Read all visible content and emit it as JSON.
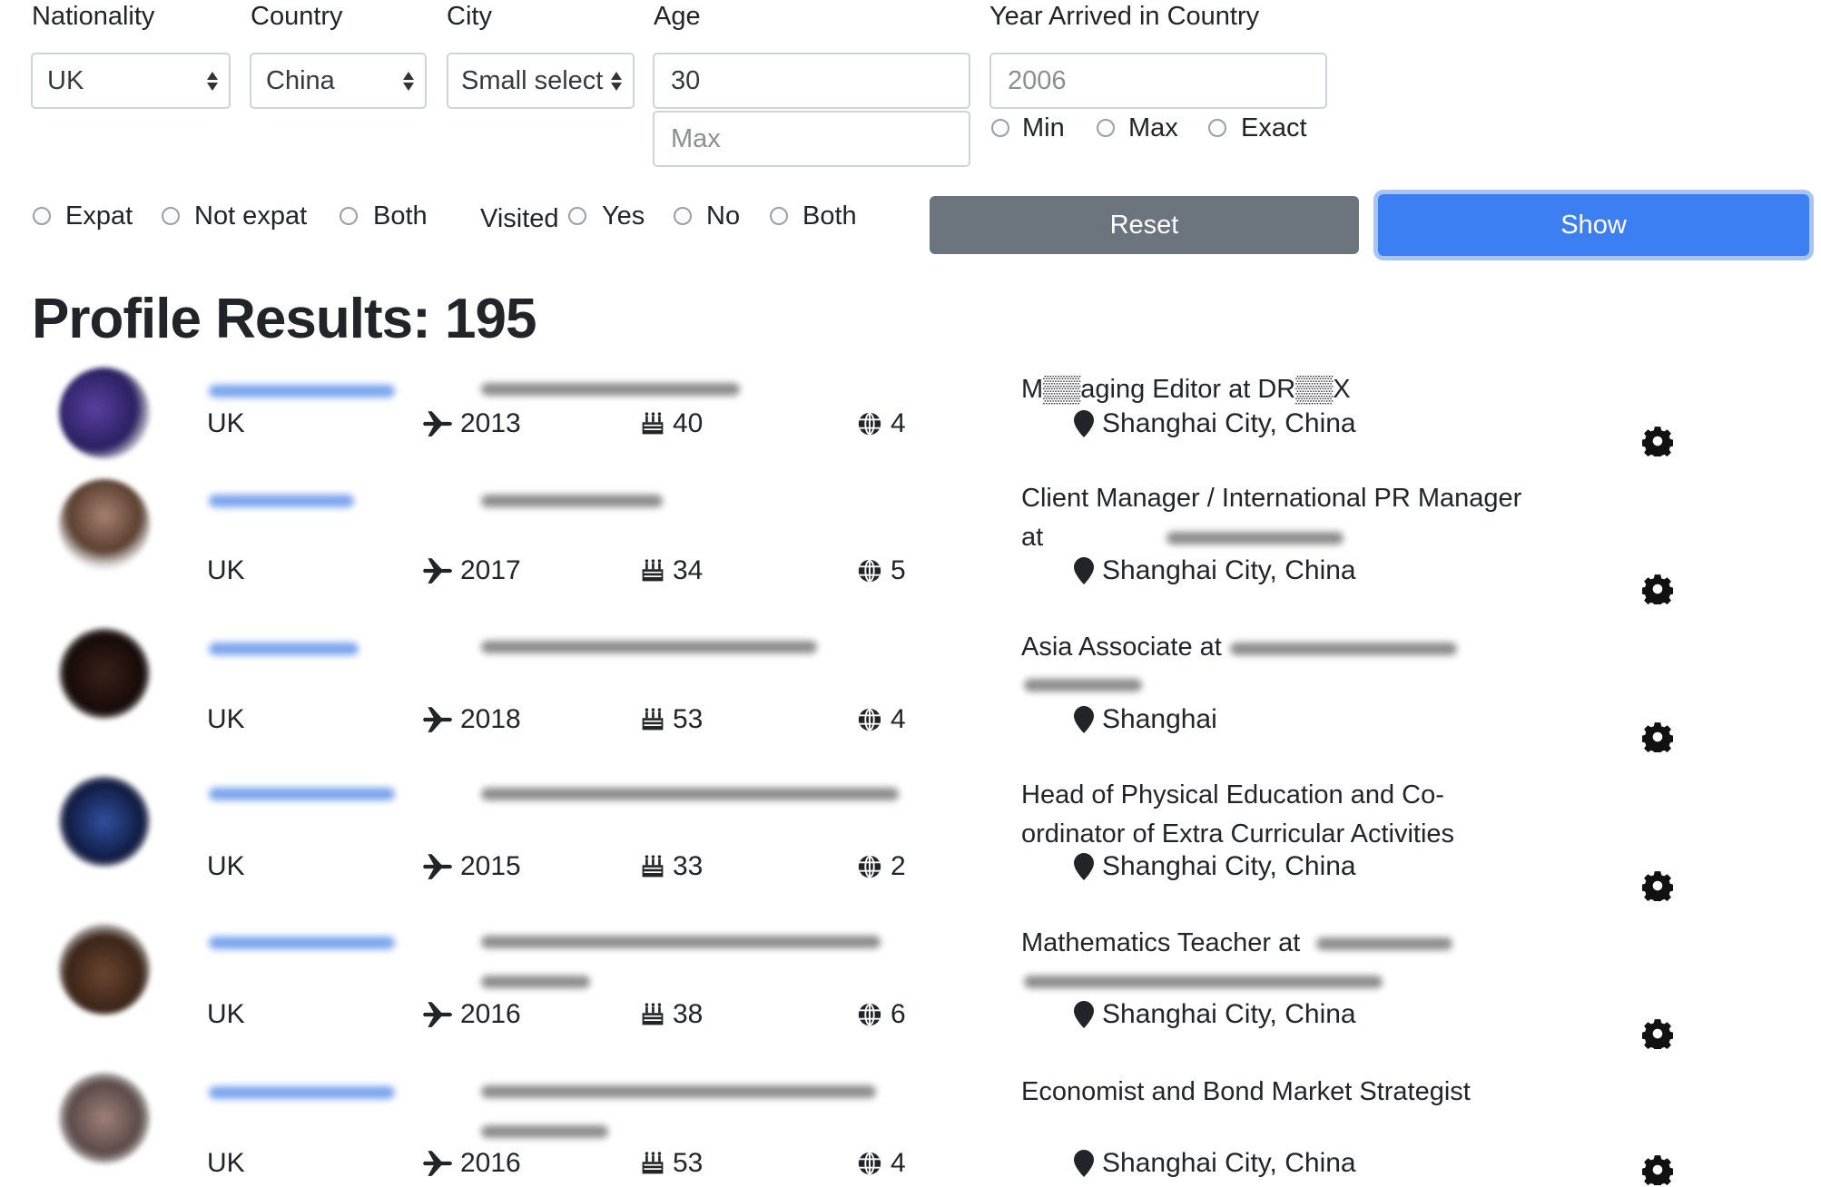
{
  "filters": {
    "nationality": {
      "label": "Nationality",
      "value": "UK"
    },
    "country": {
      "label": "Country",
      "value": "China"
    },
    "city": {
      "label": "City",
      "value": "Small select"
    },
    "age": {
      "label": "Age",
      "min_value": "30",
      "max_placeholder": "Max"
    },
    "year_arrived": {
      "label": "Year Arrived in Country",
      "placeholder": "2006",
      "options": [
        "Min",
        "Max",
        "Exact"
      ]
    },
    "expat_options": [
      "Expat",
      "Not expat",
      "Both"
    ],
    "visited": {
      "label": "Visited",
      "options": [
        "Yes",
        "No",
        "Both"
      ]
    }
  },
  "buttons": {
    "reset": "Reset",
    "show": "Show"
  },
  "results": {
    "title": "Profile Results: 195"
  },
  "colors": {
    "primary": "#3b7ff2",
    "secondary": "#6c757d"
  },
  "icons": {
    "arrived": "plane-icon",
    "age": "birthday-cake-icon",
    "languages": "globe-icon",
    "location": "map-marker-icon",
    "settings": "gear-icon"
  },
  "profiles": [
    {
      "nationality": "UK",
      "year": "2013",
      "age": "40",
      "globe": "4",
      "job": "M▒▒aging Editor at DR▒▒X",
      "location": "Shanghai City, China"
    },
    {
      "nationality": "UK",
      "year": "2017",
      "age": "34",
      "globe": "5",
      "job": "Client Manager / International PR Manager at",
      "location": "Shanghai City, China"
    },
    {
      "nationality": "UK",
      "year": "2018",
      "age": "53",
      "globe": "4",
      "job": "Asia Associate at",
      "location": "Shanghai"
    },
    {
      "nationality": "UK",
      "year": "2015",
      "age": "33",
      "globe": "2",
      "job": "Head of Physical Education and Co-ordinator of Extra Curricular Activities",
      "location": "Shanghai City, China"
    },
    {
      "nationality": "UK",
      "year": "2016",
      "age": "38",
      "globe": "6",
      "job": "Mathematics Teacher at",
      "location": "Shanghai City, China"
    },
    {
      "nationality": "UK",
      "year": "2016",
      "age": "53",
      "globe": "4",
      "job": "Economist and Bond Market Strategist",
      "location": "Shanghai City, China"
    }
  ]
}
